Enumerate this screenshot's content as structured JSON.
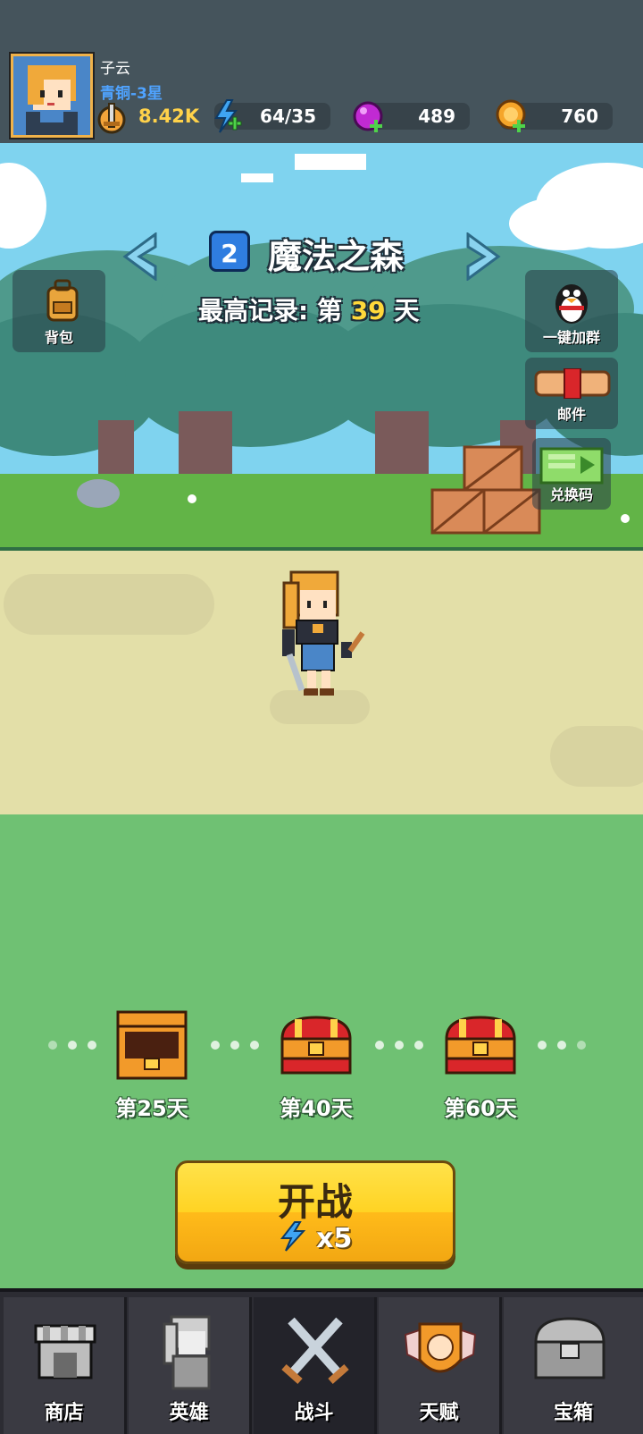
{
  "player": {
    "name": "子云",
    "rank": "青铜-3星",
    "power": "8.42K"
  },
  "resources": {
    "energy": "64/35",
    "gems": "489",
    "coins": "760"
  },
  "stage": {
    "number": "2",
    "name": "魔法之森",
    "best_record_prefix": "最高记录: 第",
    "best_record_day": "39",
    "best_record_suffix": "天"
  },
  "side_buttons": {
    "backpack": "背包",
    "join_group": "一键加群",
    "mail": "邮件",
    "redeem": "兑换码"
  },
  "chest_rewards": [
    {
      "label": "第25天",
      "state": "opened"
    },
    {
      "label": "第40天",
      "state": "locked"
    },
    {
      "label": "第60天",
      "state": "locked"
    }
  ],
  "start_button": {
    "label": "开战",
    "cost": "x5"
  },
  "bottom_nav": [
    {
      "label": "商店",
      "icon": "shop-icon"
    },
    {
      "label": "英雄",
      "icon": "hero-icon"
    },
    {
      "label": "战斗",
      "icon": "crossed-swords-icon",
      "active": true
    },
    {
      "label": "天赋",
      "icon": "talent-fist-icon"
    },
    {
      "label": "宝箱",
      "icon": "chest-icon"
    }
  ],
  "colors": {
    "topbar": "#45545c",
    "accent_yellow": "#ffd323",
    "power_text": "#ffd24a",
    "rank_text": "#4fa3ff",
    "field_green": "#6fc173"
  }
}
